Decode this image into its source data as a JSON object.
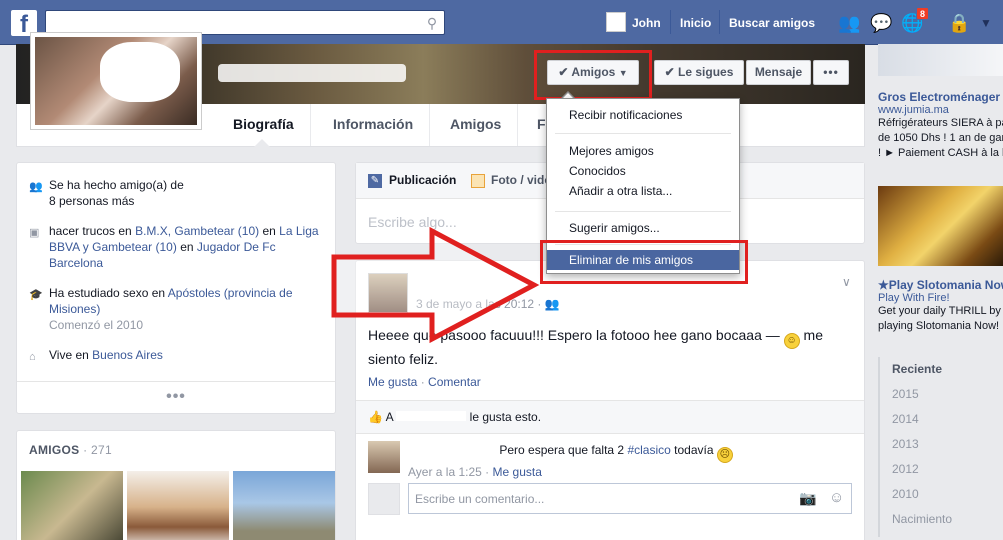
{
  "topbar": {
    "logo": "f",
    "user_name": "John",
    "nav_home": "Inicio",
    "nav_find_friends": "Buscar amigos",
    "notification_count": "8",
    "search_placeholder": ""
  },
  "profile": {
    "buttons": {
      "friends": "Amigos",
      "following": "Le sigues",
      "message": "Mensaje",
      "more": "•••"
    },
    "tabs": [
      "Biografía",
      "Información",
      "Amigos",
      "F"
    ]
  },
  "friends_menu": {
    "items": [
      "Recibir notificaciones",
      "Mejores amigos",
      "Conocidos",
      "Añadir a otra lista...",
      "Sugerir amigos...",
      "Eliminar de mis amigos"
    ],
    "highlighted_item": "Eliminar de mis amigos",
    "highlight_color": "#4a66a0",
    "annotation_color": "#e0201f"
  },
  "intro": {
    "friends_since_prefix": "Se ha hecho amigo(a) de",
    "friends_since_tail": "8 personas más",
    "likes": {
      "prefix": "hacer trucos",
      "en1": "en",
      "link1": "B.M.X, Gambetear (10)",
      "en2": "en",
      "link2": "La Liga BBVA y Gambetear (10)",
      "en3": "en",
      "link3": "Jugador De Fc Barcelona"
    },
    "study": {
      "prefix": "Ha estudiado sexo en",
      "link": "Apóstoles (provincia de Misiones)",
      "since": "Comenzó el 2010"
    },
    "lives": {
      "prefix": "Vive en",
      "link": "Buenos Aires"
    },
    "more": "•••"
  },
  "friends_box": {
    "title": "AMIGOS",
    "count": "· 271"
  },
  "composer": {
    "tab_post": "Publicación",
    "tab_photo": "Foto / vide",
    "placeholder": "Escribe algo..."
  },
  "post": {
    "time": "3 de mayo a las 20:12 ·",
    "text_before": "Heeee que pasooo facuuu!!! Espero la fotooo hee gano bocaaa — ",
    "text_after": " me siento feliz.",
    "like": "Me gusta",
    "comment": "Comentar",
    "likes_prefix": "A",
    "likes_suffix": "le gusta esto.",
    "comment1_text": "Pero espera que falta 2",
    "comment1_hashtag": "#clasico",
    "comment1_tail": "todavía",
    "comment1_time": "Ayer a la 1:25 ·",
    "comment1_like": "Me gusta",
    "comment_placeholder": "Escribe un comentario..."
  },
  "ads": {
    "ad1_title": "Gros Electroménager -",
    "ad1_url": "www.jumia.ma",
    "ad1_line1": "Réfrigérateurs SIERA à pa",
    "ad1_line2": "de 1050 Dhs ! 1 an de gar",
    "ad1_line3": "! ► Paiement CASH à la liv",
    "ad2_title": "★Play Slotomania Now",
    "ad2_sub": "Play With Fire!",
    "ad2_line1": "Get your daily THRILL by",
    "ad2_line2": "playing Slotomania Now!"
  },
  "years": [
    "Reciente",
    "2015",
    "2014",
    "2013",
    "2012",
    "2010",
    "Nacimiento"
  ]
}
